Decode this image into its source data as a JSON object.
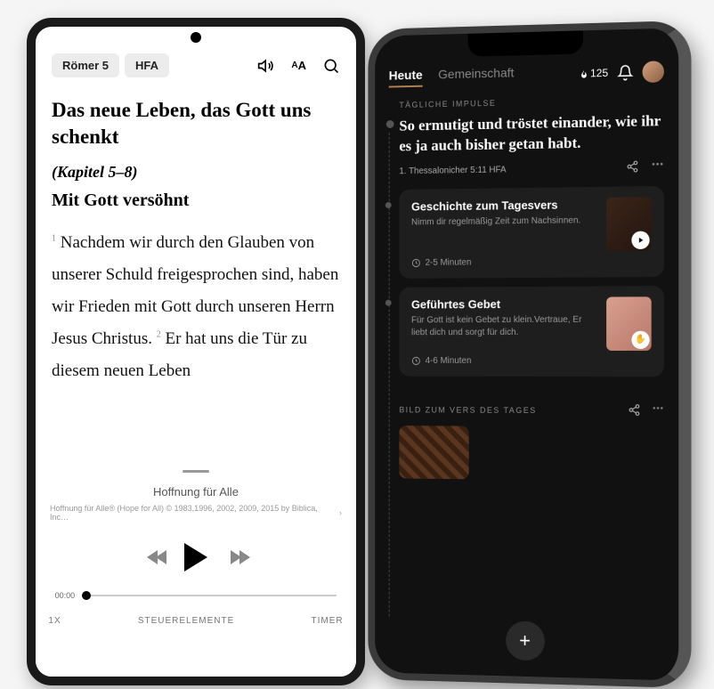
{
  "phone1": {
    "chapter_pill": "Römer 5",
    "version_pill": "HFA",
    "title": "Das neue Leben, das Gott uns schenkt",
    "subtitle": "(Kapitel 5–8)",
    "heading": "Mit Gott versöhnt",
    "verse1_num": "1",
    "verse1": " Nachdem wir durch den Glauben von unserer Schuld freigesprochen sind, haben wir Frieden mit Gott durch unseren Herrn Jesus Christus. ",
    "verse2_num": "2",
    "verse2": " Er hat uns die Tür zu diesem neuen Leben",
    "audio_title": "Hoffnung für Alle",
    "audio_copyright": "Hoffnung für Alle® (Hope for All) © 1983,1996, 2002, 2009, 2015 by Biblica, Inc…",
    "time_start": "00:00",
    "speed": "1X",
    "controls_label": "STEUERELEMENTE",
    "timer_label": "TIMER"
  },
  "phone2": {
    "tab_today": "Heute",
    "tab_community": "Gemeinschaft",
    "streak": "125",
    "section_daily": "TÄGLICHE IMPULSE",
    "verse_text": "So ermutigt und tröstet einander, wie ihr es ja auch bisher getan habt.",
    "verse_ref": "1. Thessalonicher 5:11 HFA",
    "card1": {
      "title": "Geschichte zum Tagesvers",
      "sub": "Nimm dir regelmäßig Zeit zum Nachsinnen.",
      "meta": "2-5 Minuten"
    },
    "card2": {
      "title": "Geführtes Gebet",
      "sub": "Für Gott ist kein Gebet zu klein.Vertraue, Er liebt dich und sorgt für dich.",
      "meta": "4-6 Minuten"
    },
    "section_image": "BILD ZUM VERS DES TAGES",
    "fab": "+"
  }
}
